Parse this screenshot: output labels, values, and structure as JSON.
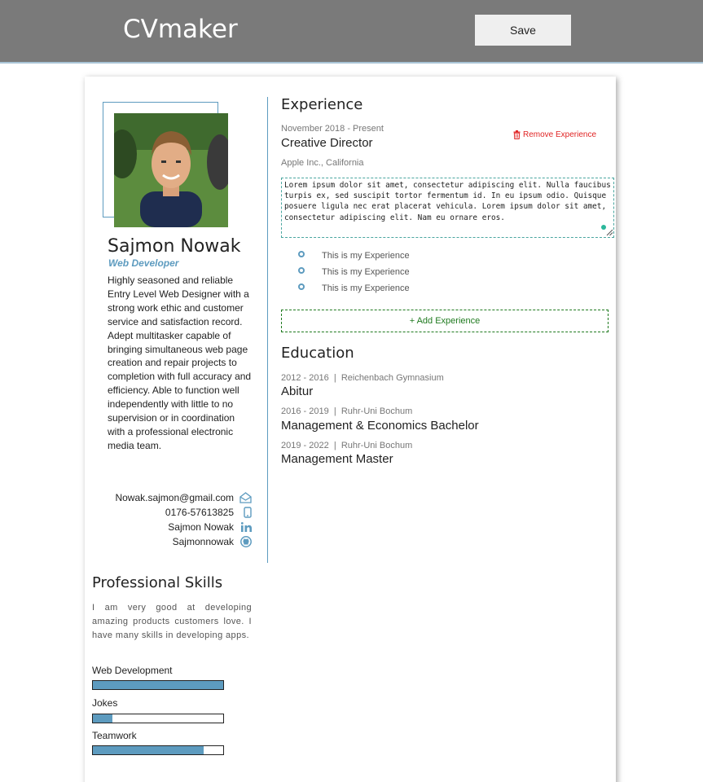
{
  "app": {
    "title": "CVmaker",
    "save_label": "Save"
  },
  "profile": {
    "name": "Sajmon Nowak",
    "role": "Web Developer",
    "bio": "Highly seasoned and reliable Entry Level Web Designer with a strong work ethic and customer service and satisfaction record. Adept multitasker capable of bringing simultaneous web page creation and repair projects to completion with full accuracy and efficiency. Able to function well independently with little to no supervision or in coordination with a professional electronic media team.",
    "contacts": [
      {
        "text": "Nowak.sajmon@gmail.com",
        "icon": "envelope-icon"
      },
      {
        "text": "0176-57613825",
        "icon": "phone-icon"
      },
      {
        "text": "Sajmon Nowak",
        "icon": "linkedin-icon"
      },
      {
        "text": "Sajmonnowak",
        "icon": "github-icon"
      }
    ]
  },
  "skills": {
    "title": "Professional Skills",
    "description": "I am very good at developing amazing products customers love. I have many skills in developing apps.",
    "items": [
      {
        "label": "Web Development",
        "level": 1.0
      },
      {
        "label": "Jokes",
        "level": 0.15
      },
      {
        "label": "Teamwork",
        "level": 0.85
      }
    ]
  },
  "experience": {
    "title": "Experience",
    "date": "November 2018 - Present",
    "position": "Creative Director",
    "company": "Apple Inc., California",
    "remove_label": "Remove Experience",
    "description": "Lorem ipsum dolor sit amet, consectetur adipiscing elit. Nulla faucibus turpis ex, sed suscipit tortor fermentum id. In eu ipsum odio. Quisque posuere ligula nec erat placerat vehicula. Lorem ipsum dolor sit amet, consectetur adipiscing elit. Nam eu ornare eros.",
    "bullets": [
      "This is my Experience",
      "This is my Experience",
      "This is my Experience"
    ],
    "add_label": "+ Add Experience"
  },
  "education": {
    "title": "Education",
    "items": [
      {
        "years": "2012 - 2016",
        "school": "Reichenbach Gymnasium",
        "degree": "Abitur"
      },
      {
        "years": "2016 - 2019",
        "school": "Ruhr-Uni Bochum",
        "degree": "Management & Economics Bachelor"
      },
      {
        "years": "2019 - 2022",
        "school": "Ruhr-Uni Bochum",
        "degree": "Management Master"
      }
    ]
  },
  "colors": {
    "accent": "#5d9bbf",
    "header": "#7a7a7a",
    "remove": "#e02424",
    "add": "#1f7a1f"
  }
}
